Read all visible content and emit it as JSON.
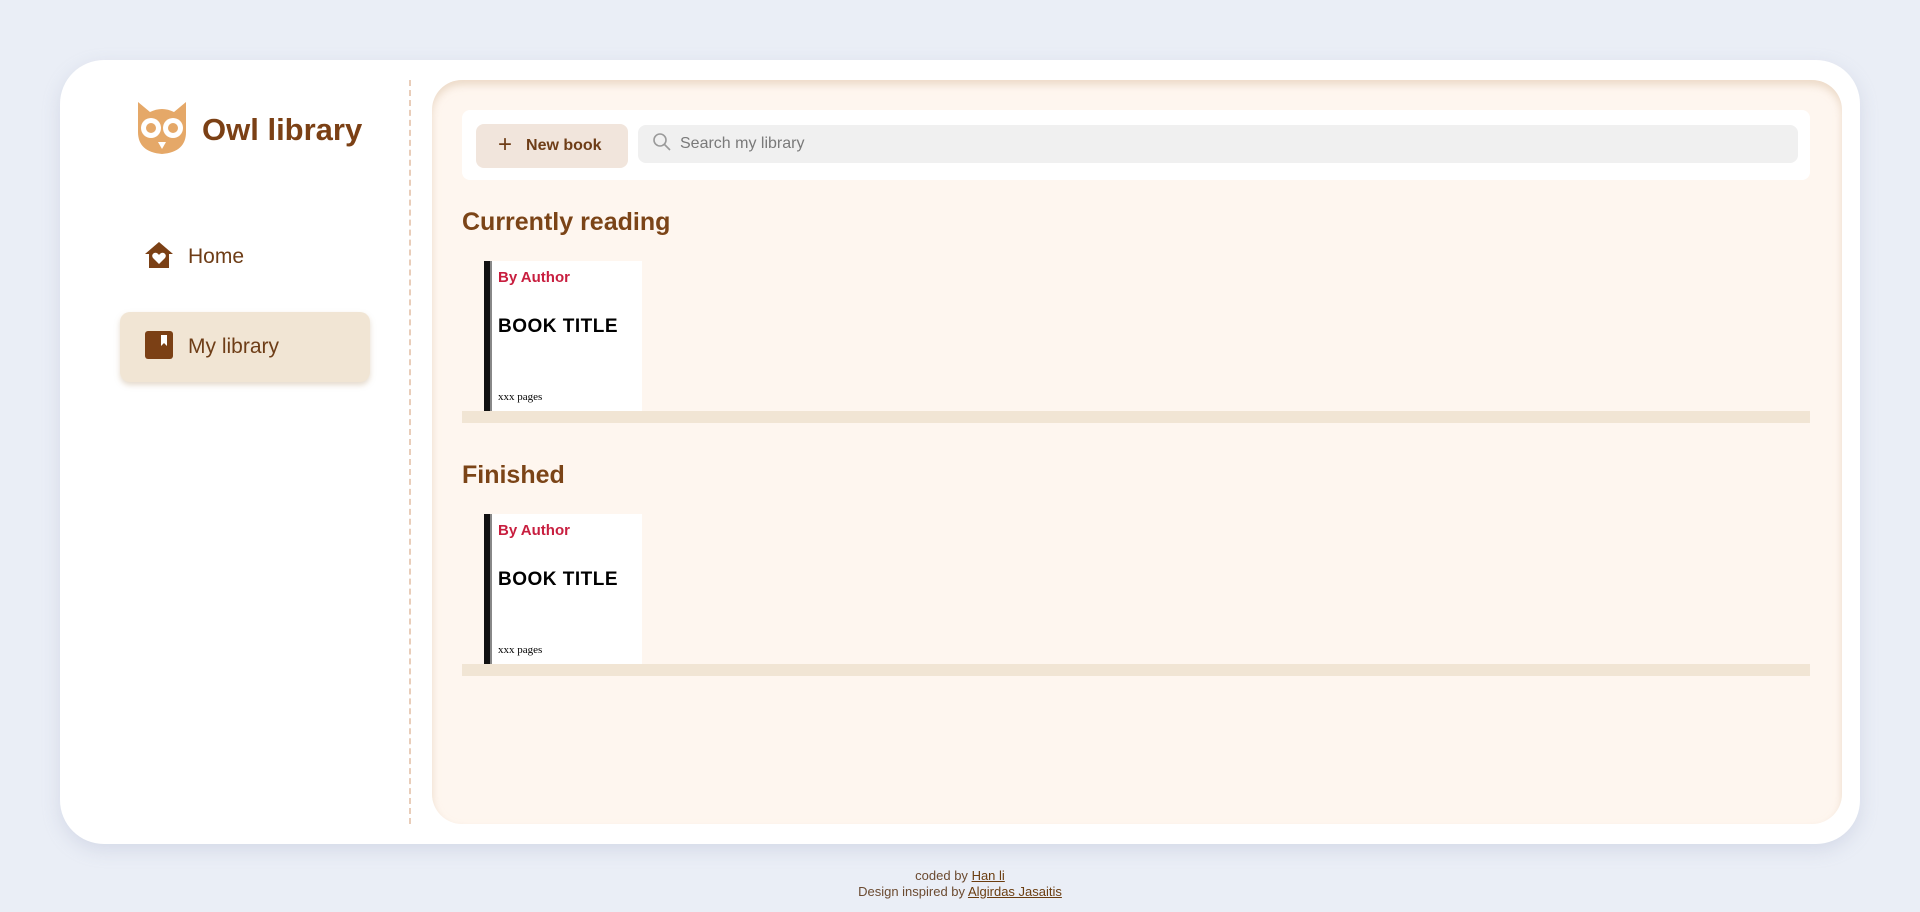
{
  "brand": {
    "title": "Owl library",
    "icon": "owl-icon",
    "color": "#7b4015"
  },
  "nav": {
    "items": [
      {
        "label": "Home",
        "icon": "house-heart-icon"
      },
      {
        "label": "My library",
        "icon": "bookmark-book-icon",
        "active": true
      }
    ]
  },
  "toolbar": {
    "new_book_label": "New book",
    "search_placeholder": "Search my library"
  },
  "sections": [
    {
      "title": "Currently reading",
      "books": [
        {
          "author": "By Author",
          "title": "BOOK TITLE",
          "pages": "xxx pages"
        }
      ]
    },
    {
      "title": "Finished",
      "books": [
        {
          "author": "By Author",
          "title": "BOOK TITLE",
          "pages": "xxx pages"
        }
      ]
    }
  ],
  "footer": {
    "coded_prefix": "coded by",
    "coded_name": "Han li",
    "design_prefix": "Design inspired by",
    "design_name": "Algirdas Jasaitis"
  },
  "colors": {
    "page_bg": "#eaeef6",
    "accent_brown": "#7b4015",
    "active_nav_bg": "#f1e5d4",
    "main_bg": "#fef6ef",
    "author_red": "#c81e3f"
  }
}
